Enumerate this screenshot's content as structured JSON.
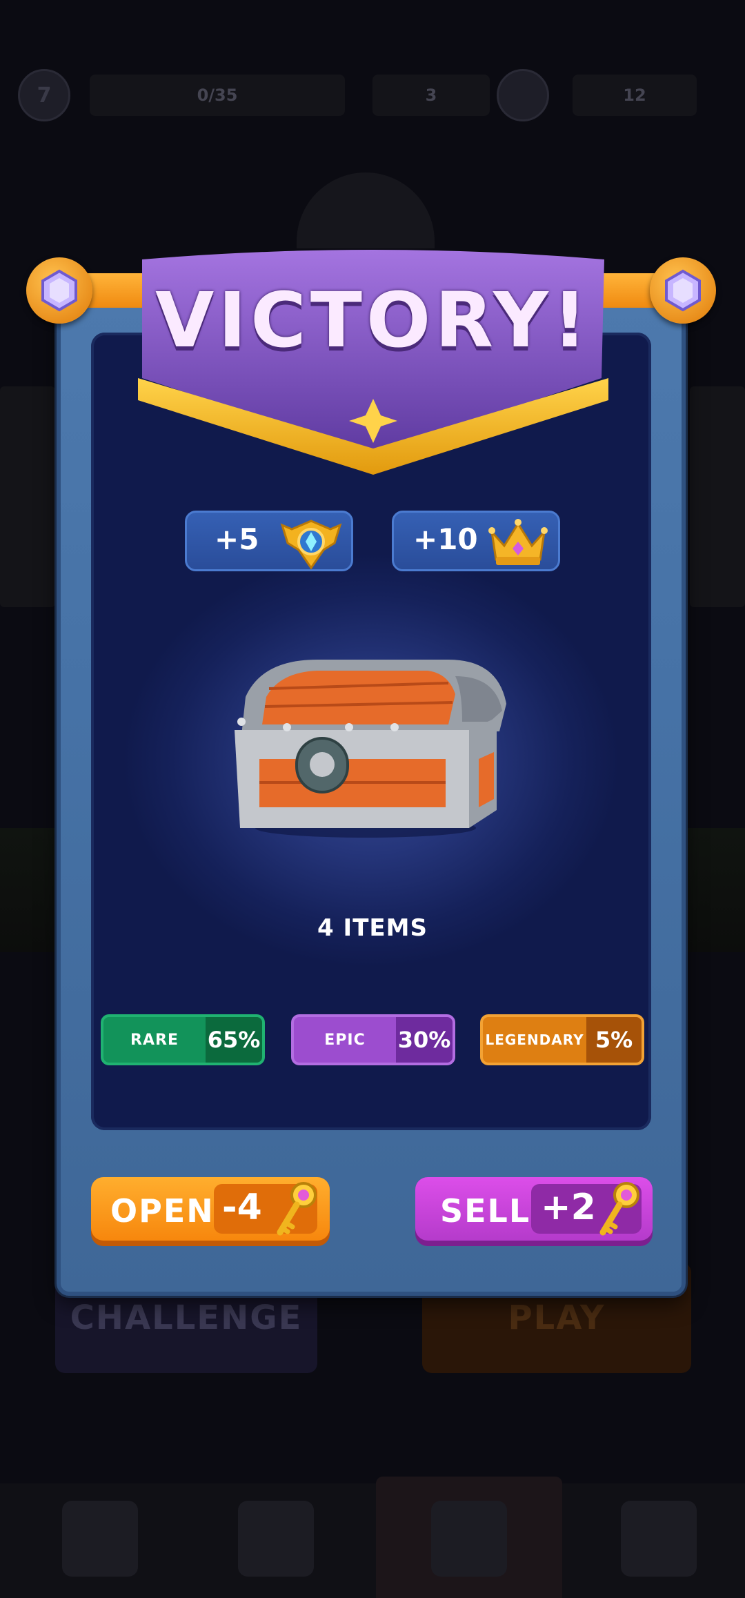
{
  "background": {
    "level_badge": "7",
    "progress_text": "0/35",
    "coins": "3",
    "keys": "12",
    "challenge_label": "CHALLENGE",
    "play_label": "PLAY"
  },
  "modal": {
    "title": "VICTORY!",
    "rewards": [
      {
        "amount": "+5",
        "icon": "wing-emblem-icon"
      },
      {
        "amount": "+10",
        "icon": "crown-icon"
      }
    ],
    "chest_items": "4 ITEMS",
    "rarities": [
      {
        "label": "RARE",
        "percent": "65%",
        "color": "#12935a"
      },
      {
        "label": "EPIC",
        "percent": "30%",
        "color": "#9c4dcf"
      },
      {
        "label": "LEGENDARY",
        "percent": "5%",
        "color": "#de7f12"
      }
    ],
    "open_button": {
      "label": "OPEN",
      "value": "-4",
      "icon": "key-icon"
    },
    "sell_button": {
      "label": "SELL",
      "value": "+2",
      "icon": "key-icon"
    }
  },
  "colors": {
    "modal_frame": "#4672a6",
    "ribbon": "#7b4bb8",
    "gold": "#f7b21c",
    "open": "#f7870d",
    "sell": "#b53bcb"
  }
}
